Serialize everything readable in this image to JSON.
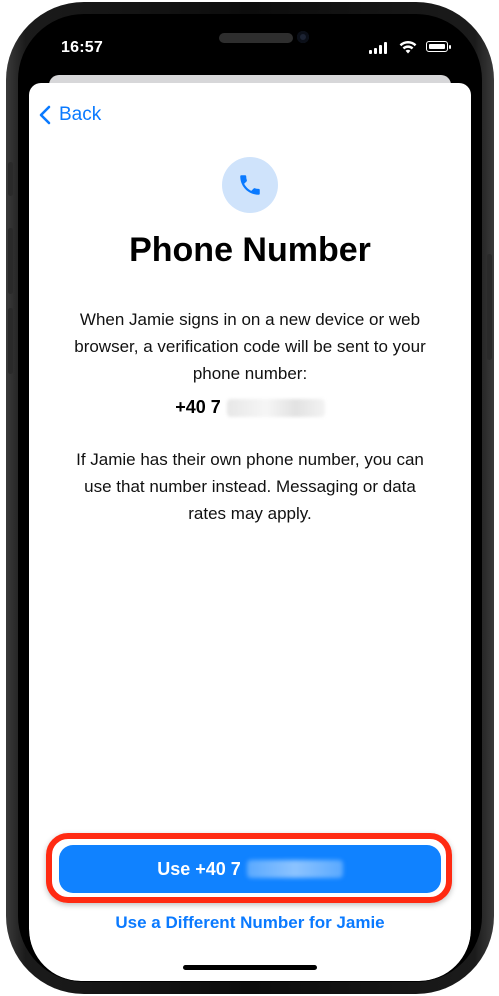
{
  "status_bar": {
    "time": "16:57"
  },
  "nav": {
    "back_label": "Back"
  },
  "content": {
    "title": "Phone Number",
    "description": "When Jamie signs in on a new device or web browser, a verification code will be sent to your phone number:",
    "phone_prefix": "+40 7",
    "secondary_text": "If Jamie has their own phone number, you can use that number instead. Messaging or data rates may apply."
  },
  "actions": {
    "primary_label": "Use +40 7",
    "secondary_label": "Use a Different Number for Jamie"
  },
  "colors": {
    "accent": "#0a7aff",
    "primary_button": "#1082ff",
    "highlight": "#ff2a12",
    "icon_bg": "#cfe3fb"
  },
  "icons": {
    "back": "chevron-left-icon",
    "phone": "phone-icon"
  }
}
